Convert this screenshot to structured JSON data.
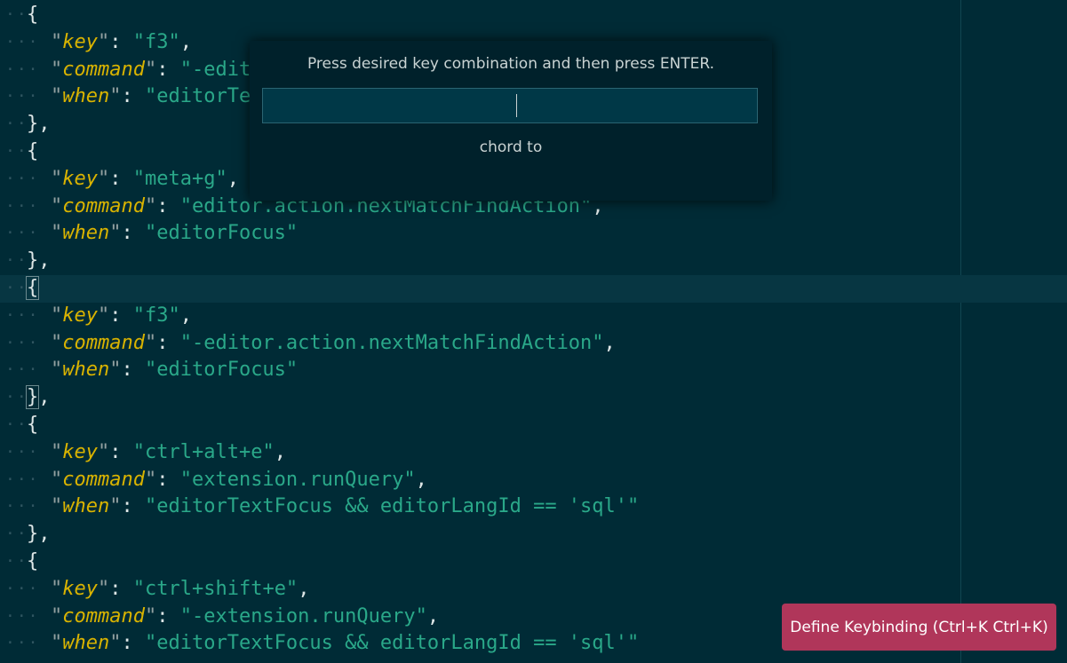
{
  "editor": {
    "lines": [
      {
        "indent": 0,
        "open": "{",
        "current": false
      },
      {
        "indent": 1,
        "key": "key",
        "value": "f3",
        "trail": ","
      },
      {
        "indent": 1,
        "key": "command",
        "value": "-editor.action.nextMatchFindAction",
        "trail": ","
      },
      {
        "indent": 1,
        "key": "when",
        "value": "editorTextFocus",
        "trail": ""
      },
      {
        "indent": 0,
        "close": "},"
      },
      {
        "indent": 0,
        "open": "{"
      },
      {
        "indent": 1,
        "key": "key",
        "value": "meta+g",
        "trail": ","
      },
      {
        "indent": 1,
        "key": "command",
        "value": "editor.action.nextMatchFindAction",
        "trail": ","
      },
      {
        "indent": 1,
        "key": "when",
        "value": "editorFocus",
        "trail": ""
      },
      {
        "indent": 0,
        "close": "},"
      },
      {
        "indent": 0,
        "open": "{",
        "current": true,
        "match": true
      },
      {
        "indent": 1,
        "key": "key",
        "value": "f3",
        "trail": ","
      },
      {
        "indent": 1,
        "key": "command",
        "value": "-editor.action.nextMatchFindAction",
        "trail": ","
      },
      {
        "indent": 1,
        "key": "when",
        "value": "editorFocus",
        "trail": ""
      },
      {
        "indent": 0,
        "close": "},",
        "match": true
      },
      {
        "indent": 0,
        "open": "{"
      },
      {
        "indent": 1,
        "key": "key",
        "value": "ctrl+alt+e",
        "trail": ","
      },
      {
        "indent": 1,
        "key": "command",
        "value": "extension.runQuery",
        "trail": ","
      },
      {
        "indent": 1,
        "key": "when",
        "value": "editorTextFocus && editorLangId == 'sql'",
        "trail": ""
      },
      {
        "indent": 0,
        "close": "},"
      },
      {
        "indent": 0,
        "open": "{"
      },
      {
        "indent": 1,
        "key": "key",
        "value": "ctrl+shift+e",
        "trail": ","
      },
      {
        "indent": 1,
        "key": "command",
        "value": "-extension.runQuery",
        "trail": ","
      },
      {
        "indent": 1,
        "key": "when",
        "value": "editorTextFocus && editorLangId == 'sql'",
        "trail": ""
      }
    ]
  },
  "dialog": {
    "prompt": "Press desired key combination and then press ENTER.",
    "input_value": "",
    "chord_label": "chord to"
  },
  "define_button": {
    "label": "Define Keybinding (Ctrl+K Ctrl+K)"
  },
  "colors": {
    "background": "#002b36",
    "key": "#d9b300",
    "string": "#2aa889",
    "button": "#b0365a"
  }
}
